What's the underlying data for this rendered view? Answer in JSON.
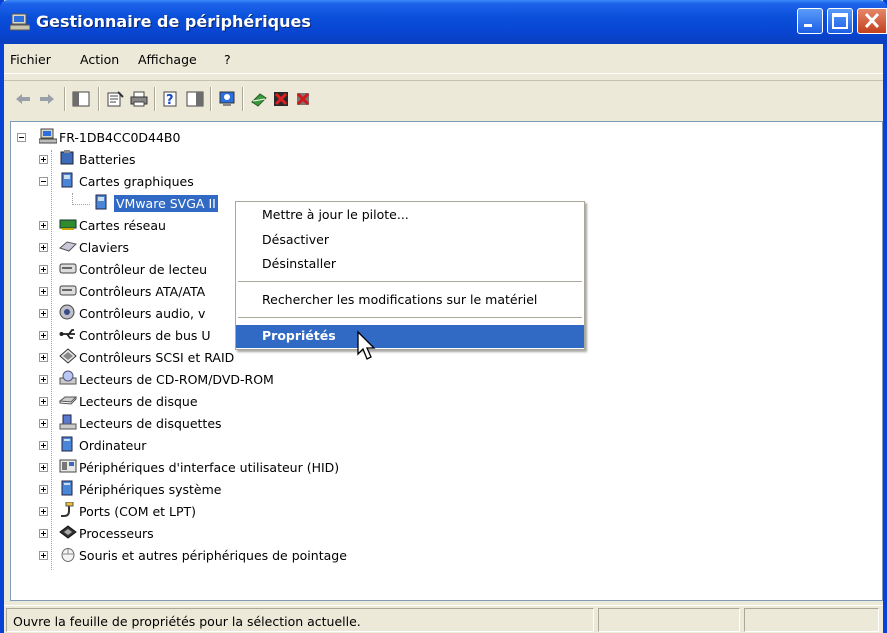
{
  "window": {
    "title": "Gestionnaire de périphériques"
  },
  "menu": [
    "Fichier",
    "Action",
    "Affichage",
    "?"
  ],
  "toolbar": {
    "icons": [
      "back-arrow-icon",
      "forward-arrow-icon",
      "show-hide-console-tree-icon",
      "properties-icon",
      "print-icon",
      "help-icon",
      "show-action-pane-icon",
      "scan-hardware-icon",
      "update-driver-icon",
      "disable-device-icon",
      "uninstall-device-icon"
    ]
  },
  "tree": {
    "root": "FR-1DB4CC0D44B0",
    "categories": [
      {
        "label": "Batteries",
        "icon": "battery-icon"
      },
      {
        "label": "Cartes graphiques",
        "icon": "display-adapter-icon",
        "expanded": true,
        "children": [
          {
            "label": "VMware SVGA II",
            "icon": "display-adapter-icon",
            "selected": true
          }
        ]
      },
      {
        "label": "Cartes réseau",
        "icon": "network-card-icon"
      },
      {
        "label": "Claviers",
        "icon": "keyboard-icon"
      },
      {
        "label": "Contrôleur de lecteu",
        "icon": "drive-controller-icon"
      },
      {
        "label": "Contrôleurs ATA/ATA",
        "icon": "ata-controller-icon"
      },
      {
        "label": "Contrôleurs audio, v",
        "icon": "audio-icon"
      },
      {
        "label": "Contrôleurs de bus U",
        "icon": "usb-icon"
      },
      {
        "label": "Contrôleurs SCSI et RAID",
        "icon": "scsi-icon"
      },
      {
        "label": "Lecteurs de CD-ROM/DVD-ROM",
        "icon": "cdrom-icon"
      },
      {
        "label": "Lecteurs de disque",
        "icon": "disk-drive-icon"
      },
      {
        "label": "Lecteurs de disquettes",
        "icon": "floppy-icon"
      },
      {
        "label": "Ordinateur",
        "icon": "computer-icon"
      },
      {
        "label": "Périphériques d'interface utilisateur (HID)",
        "icon": "hid-icon"
      },
      {
        "label": "Périphériques système",
        "icon": "system-device-icon"
      },
      {
        "label": "Ports (COM et LPT)",
        "icon": "port-icon"
      },
      {
        "label": "Processeurs",
        "icon": "processor-icon"
      },
      {
        "label": "Souris et autres périphériques de pointage",
        "icon": "mouse-icon"
      }
    ]
  },
  "context_menu": {
    "items": [
      {
        "label": "Mettre à jour le pilote..."
      },
      {
        "label": "Désactiver"
      },
      {
        "label": "Désinstaller"
      },
      {
        "label": "Rechercher les modifications sur le matériel"
      },
      {
        "label": "Propriétés",
        "highlighted": true,
        "default": true
      }
    ]
  },
  "status": {
    "text": "Ouvre la feuille de propriétés pour la sélection actuelle."
  },
  "colors": {
    "title_bar": "#0A4FD9",
    "selection": "#316AC5",
    "chrome": "#ECE9D8"
  }
}
